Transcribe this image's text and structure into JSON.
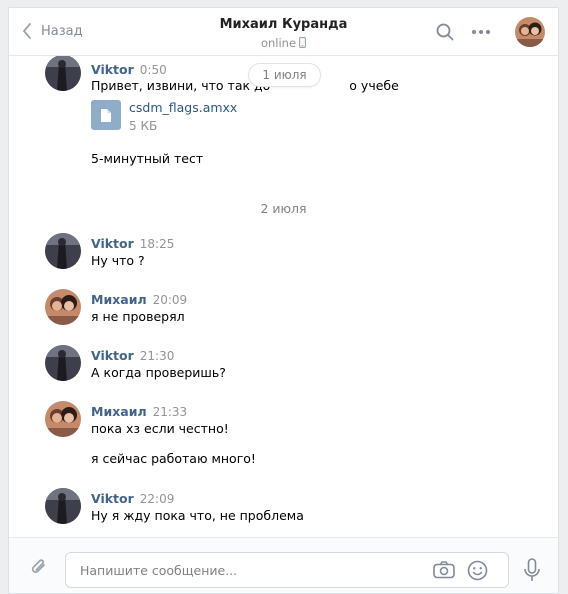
{
  "header": {
    "back_label": "Назад",
    "title": "Михаил Куранда",
    "status": "online"
  },
  "history": {
    "floating_date": "1 июля",
    "date_separator": "2 июля",
    "messages": [
      {
        "author": "Viktor",
        "time": "0:50",
        "lines": [
          "Привет, извини, что так до",
          "о учебе"
        ],
        "attachment": {
          "name": "csdm_flags.amxx",
          "size": "5 КБ"
        },
        "extra": "5-минутный тест"
      },
      {
        "author": "Viktor",
        "time": "18:25",
        "lines": [
          "Ну что ?"
        ]
      },
      {
        "author": "Михаил",
        "time": "20:09",
        "lines": [
          "я не проверял"
        ]
      },
      {
        "author": "Viktor",
        "time": "21:30",
        "lines": [
          "А когда проверишь?"
        ]
      },
      {
        "author": "Михаил",
        "time": "21:33",
        "lines": [
          "пока хз если честно!",
          "я сейчас работаю много!"
        ]
      },
      {
        "author": "Viktor",
        "time": "22:09",
        "lines": [
          "Ну я жду пока что, не проблема"
        ]
      }
    ]
  },
  "composer": {
    "placeholder": "Напишите сообщение..."
  },
  "colors": {
    "author": "#42648b",
    "accent": "#2a5885",
    "file_icon": "#8fadc8"
  }
}
